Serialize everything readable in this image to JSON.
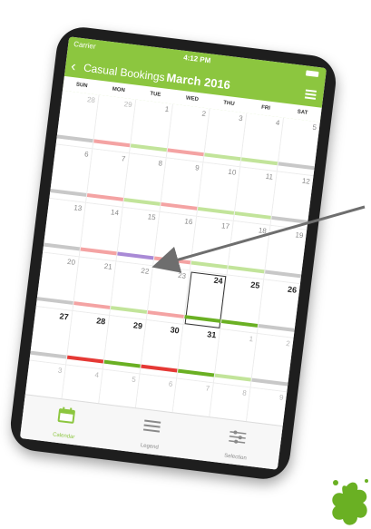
{
  "status": {
    "carrier": "Carrier",
    "time": "4:12 PM"
  },
  "nav": {
    "back_label": "Casual Bookings",
    "title": "March 2016"
  },
  "weekdays": [
    "SUN",
    "MON",
    "TUE",
    "WED",
    "THU",
    "FRI",
    "SAT"
  ],
  "colors": {
    "brand": "#8cc63f",
    "booked_light": "#f4a3a3",
    "booked_dark": "#e53935",
    "available_light": "#c2e49a",
    "available_dark": "#6ab023",
    "selected": "#a98ad6",
    "unavailable": "#c8c8c8"
  },
  "weeks": [
    {
      "days": [
        {
          "n": "28",
          "outside": true,
          "top": null,
          "bottom": "unavailable"
        },
        {
          "n": "29",
          "outside": true,
          "top": null,
          "bottom": "booked_light"
        },
        {
          "n": "1",
          "top": null,
          "bottom": "available_light"
        },
        {
          "n": "2",
          "top": null,
          "bottom": "booked_light"
        },
        {
          "n": "3",
          "top": null,
          "bottom": "available_light"
        },
        {
          "n": "4",
          "top": null,
          "bottom": "available_light"
        },
        {
          "n": "5",
          "top": null,
          "bottom": "unavailable"
        }
      ]
    },
    {
      "days": [
        {
          "n": "6",
          "top": null,
          "bottom": "unavailable"
        },
        {
          "n": "7",
          "top": null,
          "bottom": "booked_light"
        },
        {
          "n": "8",
          "top": null,
          "bottom": "available_light"
        },
        {
          "n": "9",
          "top": null,
          "bottom": "booked_light"
        },
        {
          "n": "10",
          "top": null,
          "bottom": "available_light"
        },
        {
          "n": "11",
          "top": null,
          "bottom": "available_light"
        },
        {
          "n": "12",
          "top": null,
          "bottom": "unavailable"
        }
      ]
    },
    {
      "days": [
        {
          "n": "13",
          "top": null,
          "bottom": "unavailable"
        },
        {
          "n": "14",
          "top": null,
          "bottom": "booked_light"
        },
        {
          "n": "15",
          "top": null,
          "bottom": "selected"
        },
        {
          "n": "16",
          "top": null,
          "bottom": "booked_light"
        },
        {
          "n": "17",
          "top": null,
          "bottom": "available_light"
        },
        {
          "n": "18",
          "top": null,
          "bottom": "available_light"
        },
        {
          "n": "19",
          "top": null,
          "bottom": "unavailable"
        }
      ]
    },
    {
      "days": [
        {
          "n": "20",
          "top": null,
          "bottom": "unavailable"
        },
        {
          "n": "21",
          "top": null,
          "bottom": "booked_light"
        },
        {
          "n": "22",
          "top": null,
          "bottom": "available_light"
        },
        {
          "n": "23",
          "top": null,
          "bottom": "booked_light"
        },
        {
          "n": "24",
          "bold": true,
          "today": true,
          "top": null,
          "bottom": "available_dark"
        },
        {
          "n": "25",
          "bold": true,
          "top": null,
          "bottom": "available_dark"
        },
        {
          "n": "26",
          "bold": true,
          "top": null,
          "bottom": "unavailable"
        }
      ]
    },
    {
      "days": [
        {
          "n": "27",
          "bold": true,
          "top": null,
          "bottom": "unavailable"
        },
        {
          "n": "28",
          "bold": true,
          "top": null,
          "bottom": "booked_dark"
        },
        {
          "n": "29",
          "bold": true,
          "top": null,
          "bottom": "available_dark"
        },
        {
          "n": "30",
          "bold": true,
          "top": null,
          "bottom": "booked_dark"
        },
        {
          "n": "31",
          "bold": true,
          "top": null,
          "bottom": "available_dark"
        },
        {
          "n": "1",
          "outside": true,
          "top": null,
          "bottom": "available_light"
        },
        {
          "n": "2",
          "outside": true,
          "top": null,
          "bottom": "unavailable"
        }
      ]
    },
    {
      "days": [
        {
          "n": "3",
          "outside": true,
          "top": null,
          "bottom": "unavailable"
        },
        {
          "n": "4",
          "outside": true,
          "top": null,
          "bottom": null
        },
        {
          "n": "5",
          "outside": true,
          "top": null,
          "bottom": null
        },
        {
          "n": "6",
          "outside": true,
          "top": null,
          "bottom": null
        },
        {
          "n": "7",
          "outside": true,
          "top": null,
          "bottom": null
        },
        {
          "n": "8",
          "outside": true,
          "top": null,
          "bottom": null
        },
        {
          "n": "9",
          "outside": true,
          "top": null,
          "bottom": "unavailable"
        }
      ]
    }
  ],
  "tabs": [
    {
      "label": "Calendar",
      "icon": "calendar-icon",
      "active": true
    },
    {
      "label": "Legend",
      "icon": "list-icon",
      "active": false
    },
    {
      "label": "Selection",
      "icon": "sliders-icon",
      "active": false
    }
  ]
}
